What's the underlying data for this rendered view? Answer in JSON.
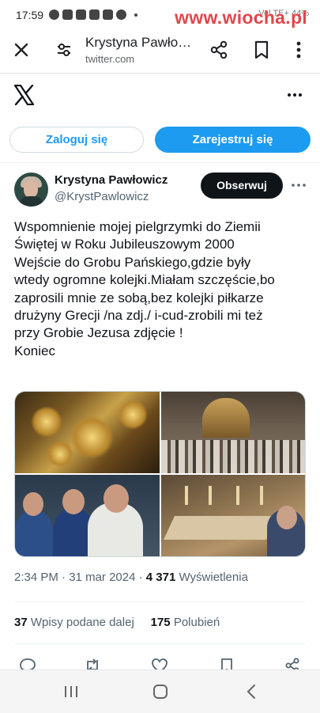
{
  "status_bar": {
    "time": "17:59",
    "right_text": "VoLTE+ 44%"
  },
  "watermark": "www.wiocha.pl",
  "browser": {
    "page_title": "Krystyna Pawło…",
    "url": "twitter.com"
  },
  "auth": {
    "login_label": "Zaloguj się",
    "signup_label": "Zarejestruj się"
  },
  "tweet": {
    "author_name": "Krystyna Pawłowicz",
    "author_handle": "@KrystPawlowicz",
    "follow_label": "Obserwuj",
    "text_lines": [
      "Wspomnienie mojej pielgrzymki do Ziemii",
      "Świętej w Roku Jubileuszowym 2000",
      "Wejście do Grobu Pańskiego,gdzie były",
      "wtedy ogromne kolejki.Miałam szczęście,bo",
      "zaprosili mnie ze sobą,bez kolejki piłkarze",
      "drużyny Grecji /na zdj./ i-cud-zrobili mi też",
      "przy Grobie Jezusa zdjęcie !",
      "Koniec"
    ],
    "time": "2:34 PM",
    "date": "31 mar 2024",
    "separator": "·",
    "views_count": "4 371",
    "views_label": "Wyświetlenia",
    "reposts_count": "37",
    "reposts_label": "Wpisy podane dalej",
    "likes_count": "175",
    "likes_label": "Polubień"
  },
  "icons": {
    "browser": [
      "close-icon",
      "tune-icon",
      "share-icon",
      "bookmark-icon",
      "more-vert-icon"
    ],
    "actions": [
      "reply-icon",
      "repost-icon",
      "like-icon",
      "bookmark-icon",
      "share-icon"
    ],
    "nav": [
      "recents-icon",
      "home-icon",
      "back-icon"
    ]
  },
  "colors": {
    "accent": "#1d9bf0",
    "follow_button": "#0f1419",
    "watermark": "#e0474c"
  }
}
